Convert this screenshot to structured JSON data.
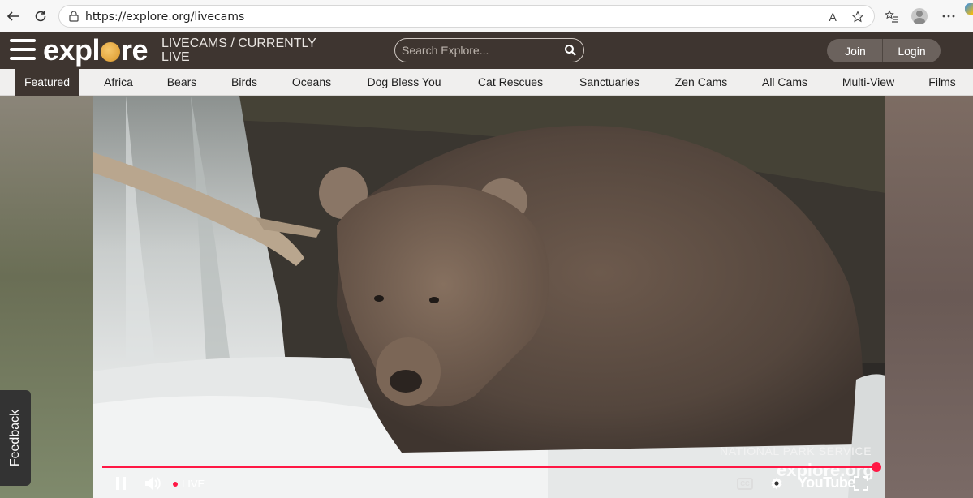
{
  "browser": {
    "url": "https://explore.org/livecams"
  },
  "header": {
    "logo_start": "expl",
    "logo_end": "re",
    "tagline_line1": "LIVECAMS / CURRENTLY",
    "tagline_line2": "LIVE",
    "search_placeholder": "Search Explore...",
    "join_label": "Join",
    "login_label": "Login"
  },
  "nav": {
    "items": [
      {
        "label": "Featured",
        "active": true
      },
      {
        "label": "Africa"
      },
      {
        "label": "Bears"
      },
      {
        "label": "Birds"
      },
      {
        "label": "Oceans"
      },
      {
        "label": "Dog Bless You"
      },
      {
        "label": "Cat Rescues"
      },
      {
        "label": "Sanctuaries"
      },
      {
        "label": "Zen Cams"
      },
      {
        "label": "All Cams"
      },
      {
        "label": "Multi-View"
      },
      {
        "label": "Films"
      }
    ]
  },
  "video": {
    "overlay_text": "NATIONAL PARK SERVICE",
    "watermark": "explore.org",
    "live_label": "LIVE",
    "cc_label": "CC",
    "youtube_label": "YouTube",
    "progress": 1.0
  },
  "feedback_label": "Feedback",
  "icons": {
    "back": "back-arrow-icon",
    "refresh": "refresh-icon",
    "lock": "lock-icon",
    "read_aloud": "read-aloud-icon",
    "favorite": "star-icon",
    "favorites_list": "favorites-list-icon",
    "profile": "profile-icon",
    "more": "more-icon",
    "hamburger": "hamburger-menu-icon",
    "search": "search-icon",
    "pause": "pause-icon",
    "volume": "volume-icon",
    "settings": "settings-icon",
    "fullscreen": "fullscreen-icon"
  },
  "colors": {
    "header_bg": "#3e3530",
    "progress_red": "#ff1744",
    "button_bg": "#6b625d"
  }
}
